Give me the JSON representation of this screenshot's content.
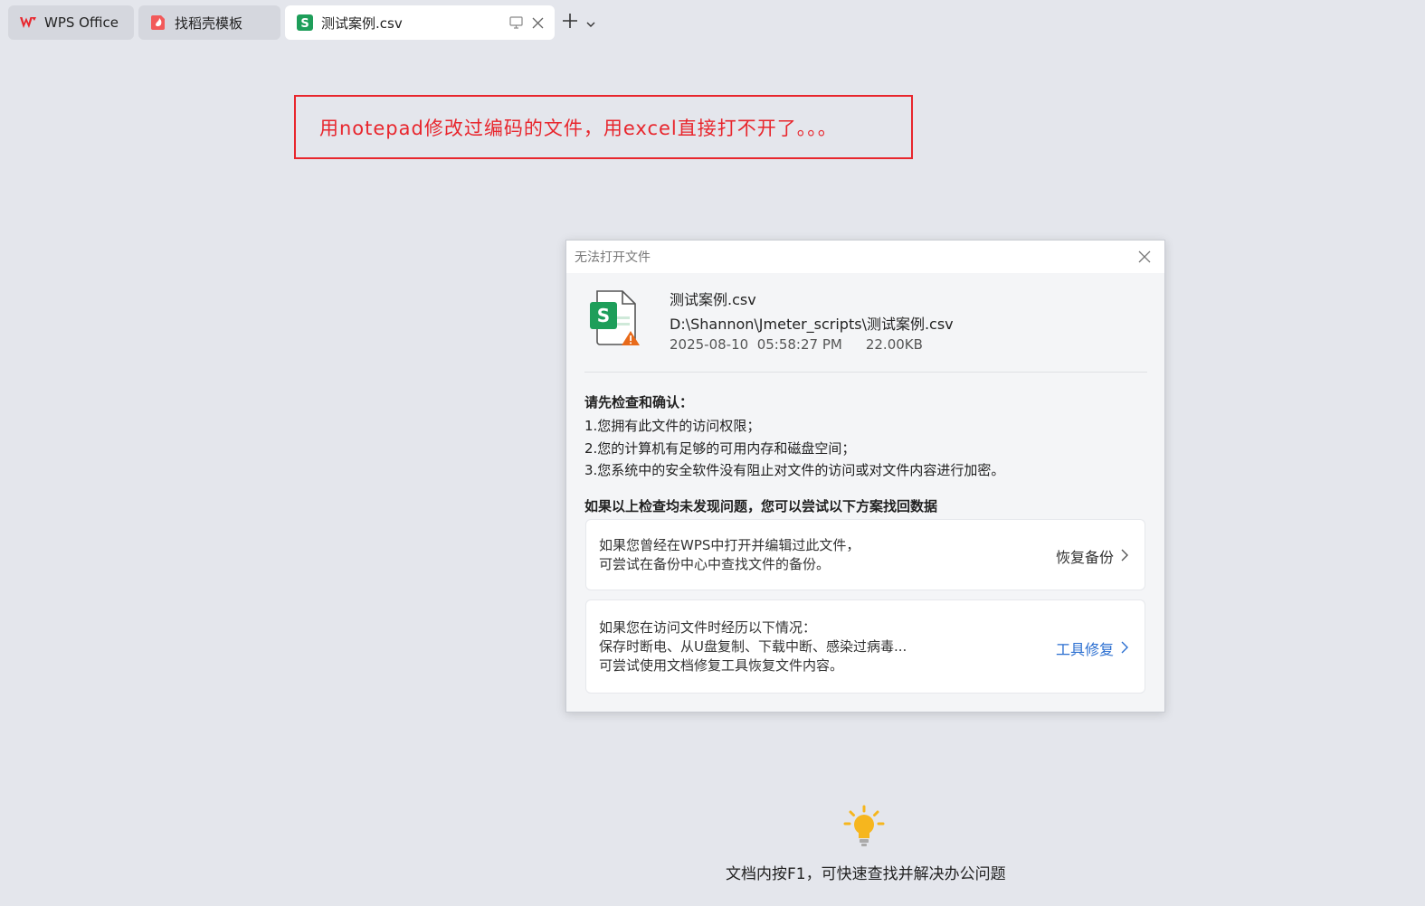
{
  "tabs": [
    {
      "label": "WPS Office",
      "icon": "wps-logo-icon",
      "state": "inactive"
    },
    {
      "label": "找稻壳模板",
      "icon": "docer-icon",
      "state": "inactive"
    },
    {
      "label": "测试案例.csv",
      "icon": "spreadsheet-s-icon",
      "state": "active"
    }
  ],
  "annotation": {
    "text": "用notepad修改过编码的文件，用excel直接打不开了。。。",
    "color": "#e8262d"
  },
  "dialog": {
    "title": "无法打开文件",
    "file": {
      "name": "测试案例.csv",
      "path": "D:\\Shannon\\Jmeter_scripts\\测试案例.csv",
      "datetime": "2025-08-10  05:58:27 PM",
      "size": "22.00KB"
    },
    "check_heading": "请先检查和确认：",
    "check_items": [
      "1.您拥有此文件的访问权限；",
      "2.您的计算机有足够的可用内存和磁盘空间；",
      "3.您系统中的安全软件没有阻止对文件的访问或对文件内容进行加密。"
    ],
    "solve_heading": "如果以上检查均未发现问题，您可以尝试以下方案找回数据",
    "cards": [
      {
        "lines": [
          "如果您曾经在WPS中打开并编辑过此文件，",
          "可尝试在备份中心中查找文件的备份。"
        ],
        "action": "恢复备份"
      },
      {
        "lines": [
          "如果您在访问文件时经历以下情况：",
          "保存时断电、从U盘复制、下载中断、感染过病毒...",
          "可尝试使用文档修复工具恢复文件内容。"
        ],
        "action": "工具修复"
      }
    ]
  },
  "hint": "文档内按F1，可快速查找并解决办公问题",
  "colors": {
    "accent_blue": "#2a6ed0",
    "wps_red": "#e8262d",
    "sheet_green": "#1e9e5a",
    "bulb_yellow": "#f6b61e"
  }
}
